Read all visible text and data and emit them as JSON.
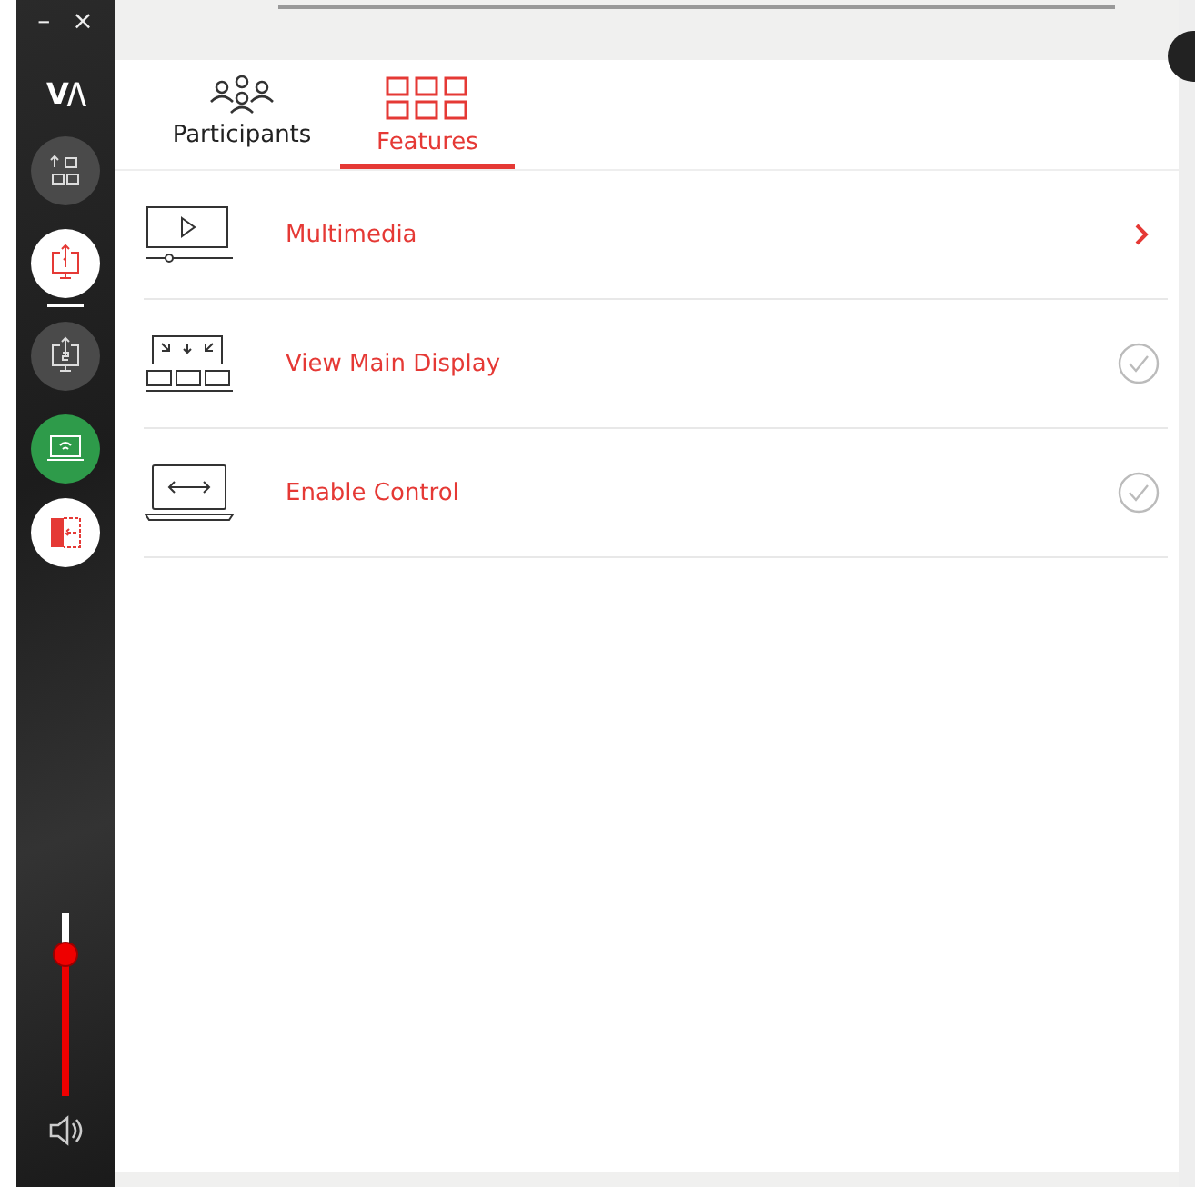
{
  "window": {
    "controls": [
      "–",
      "×"
    ]
  },
  "sidebar": {
    "logo": "V/\\",
    "buttons": [
      {
        "kind": "layout",
        "selected": false
      },
      {
        "kind": "share1",
        "selected": true
      },
      {
        "kind": "share2",
        "selected": false
      },
      {
        "kind": "wireless"
      },
      {
        "kind": "exit"
      }
    ],
    "volume": {
      "level": 0.77
    }
  },
  "tabs": [
    {
      "label": "Participants",
      "kind": "people",
      "selected": false
    },
    {
      "label": "Features",
      "kind": "grid",
      "selected": true
    }
  ],
  "features": [
    {
      "label": "Multimedia",
      "kind": "link",
      "icon": {
        "kind": "media"
      }
    },
    {
      "label": "View Main Display",
      "kind": "toggle",
      "icon": {
        "kind": "display"
      },
      "checked": false
    },
    {
      "label": "Enable Control",
      "kind": "toggle",
      "icon": {
        "kind": "control"
      },
      "checked": false
    }
  ]
}
